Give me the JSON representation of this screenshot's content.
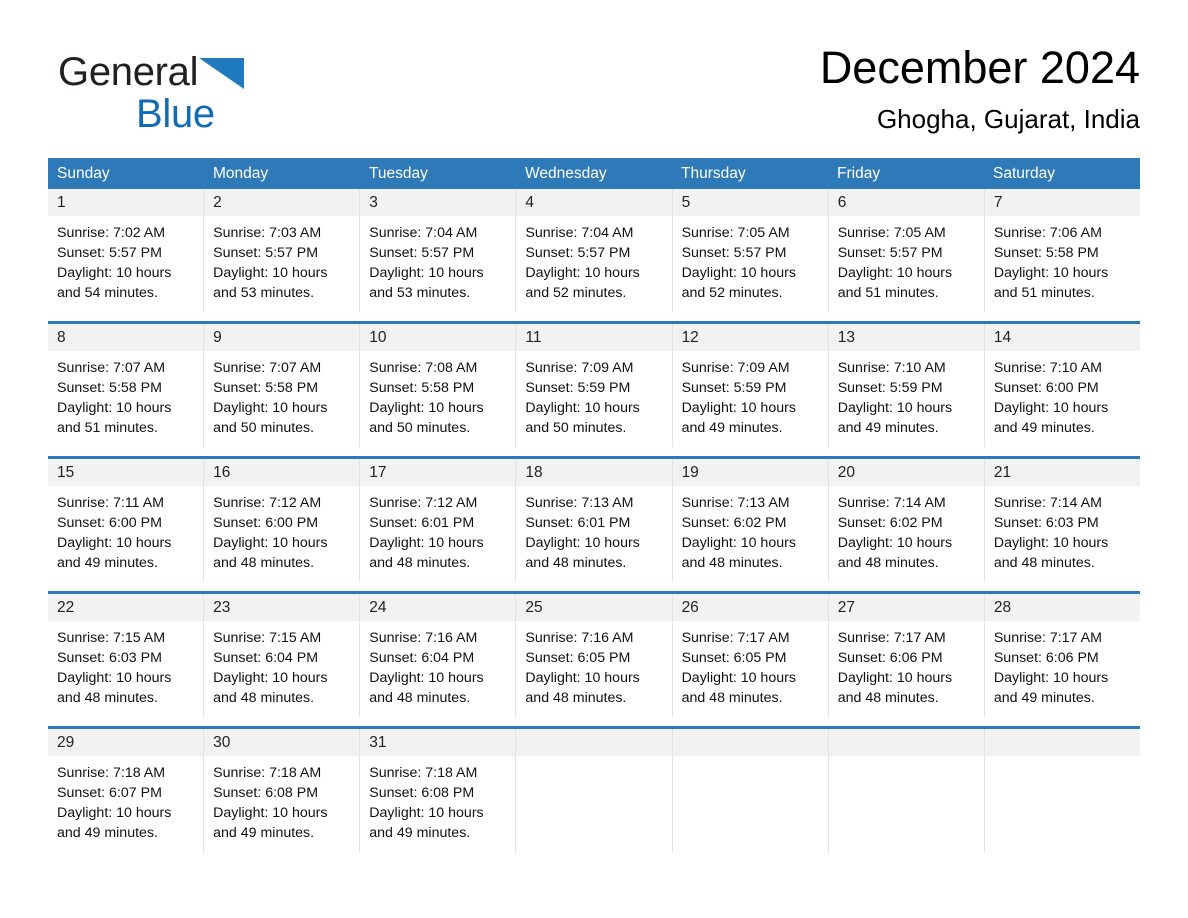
{
  "brand": {
    "name_part1": "General",
    "name_part2": "Blue",
    "triangle_color": "#1f7ac0",
    "text_color_part2": "#0f6cb5"
  },
  "header": {
    "month_title": "December 2024",
    "location": "Ghogha, Gujarat, India"
  },
  "colors": {
    "header_blue": "#2e7ab8",
    "row_rule_blue": "#2e7ab8",
    "day_band_gray": "#f2f2f2",
    "cell_divider": "#e3e3e3"
  },
  "weekdays": [
    "Sunday",
    "Monday",
    "Tuesday",
    "Wednesday",
    "Thursday",
    "Friday",
    "Saturday"
  ],
  "weeks": [
    [
      {
        "day": "1",
        "sunrise": "Sunrise: 7:02 AM",
        "sunset": "Sunset: 5:57 PM",
        "daylight1": "Daylight: 10 hours",
        "daylight2": "and 54 minutes."
      },
      {
        "day": "2",
        "sunrise": "Sunrise: 7:03 AM",
        "sunset": "Sunset: 5:57 PM",
        "daylight1": "Daylight: 10 hours",
        "daylight2": "and 53 minutes."
      },
      {
        "day": "3",
        "sunrise": "Sunrise: 7:04 AM",
        "sunset": "Sunset: 5:57 PM",
        "daylight1": "Daylight: 10 hours",
        "daylight2": "and 53 minutes."
      },
      {
        "day": "4",
        "sunrise": "Sunrise: 7:04 AM",
        "sunset": "Sunset: 5:57 PM",
        "daylight1": "Daylight: 10 hours",
        "daylight2": "and 52 minutes."
      },
      {
        "day": "5",
        "sunrise": "Sunrise: 7:05 AM",
        "sunset": "Sunset: 5:57 PM",
        "daylight1": "Daylight: 10 hours",
        "daylight2": "and 52 minutes."
      },
      {
        "day": "6",
        "sunrise": "Sunrise: 7:05 AM",
        "sunset": "Sunset: 5:57 PM",
        "daylight1": "Daylight: 10 hours",
        "daylight2": "and 51 minutes."
      },
      {
        "day": "7",
        "sunrise": "Sunrise: 7:06 AM",
        "sunset": "Sunset: 5:58 PM",
        "daylight1": "Daylight: 10 hours",
        "daylight2": "and 51 minutes."
      }
    ],
    [
      {
        "day": "8",
        "sunrise": "Sunrise: 7:07 AM",
        "sunset": "Sunset: 5:58 PM",
        "daylight1": "Daylight: 10 hours",
        "daylight2": "and 51 minutes."
      },
      {
        "day": "9",
        "sunrise": "Sunrise: 7:07 AM",
        "sunset": "Sunset: 5:58 PM",
        "daylight1": "Daylight: 10 hours",
        "daylight2": "and 50 minutes."
      },
      {
        "day": "10",
        "sunrise": "Sunrise: 7:08 AM",
        "sunset": "Sunset: 5:58 PM",
        "daylight1": "Daylight: 10 hours",
        "daylight2": "and 50 minutes."
      },
      {
        "day": "11",
        "sunrise": "Sunrise: 7:09 AM",
        "sunset": "Sunset: 5:59 PM",
        "daylight1": "Daylight: 10 hours",
        "daylight2": "and 50 minutes."
      },
      {
        "day": "12",
        "sunrise": "Sunrise: 7:09 AM",
        "sunset": "Sunset: 5:59 PM",
        "daylight1": "Daylight: 10 hours",
        "daylight2": "and 49 minutes."
      },
      {
        "day": "13",
        "sunrise": "Sunrise: 7:10 AM",
        "sunset": "Sunset: 5:59 PM",
        "daylight1": "Daylight: 10 hours",
        "daylight2": "and 49 minutes."
      },
      {
        "day": "14",
        "sunrise": "Sunrise: 7:10 AM",
        "sunset": "Sunset: 6:00 PM",
        "daylight1": "Daylight: 10 hours",
        "daylight2": "and 49 minutes."
      }
    ],
    [
      {
        "day": "15",
        "sunrise": "Sunrise: 7:11 AM",
        "sunset": "Sunset: 6:00 PM",
        "daylight1": "Daylight: 10 hours",
        "daylight2": "and 49 minutes."
      },
      {
        "day": "16",
        "sunrise": "Sunrise: 7:12 AM",
        "sunset": "Sunset: 6:00 PM",
        "daylight1": "Daylight: 10 hours",
        "daylight2": "and 48 minutes."
      },
      {
        "day": "17",
        "sunrise": "Sunrise: 7:12 AM",
        "sunset": "Sunset: 6:01 PM",
        "daylight1": "Daylight: 10 hours",
        "daylight2": "and 48 minutes."
      },
      {
        "day": "18",
        "sunrise": "Sunrise: 7:13 AM",
        "sunset": "Sunset: 6:01 PM",
        "daylight1": "Daylight: 10 hours",
        "daylight2": "and 48 minutes."
      },
      {
        "day": "19",
        "sunrise": "Sunrise: 7:13 AM",
        "sunset": "Sunset: 6:02 PM",
        "daylight1": "Daylight: 10 hours",
        "daylight2": "and 48 minutes."
      },
      {
        "day": "20",
        "sunrise": "Sunrise: 7:14 AM",
        "sunset": "Sunset: 6:02 PM",
        "daylight1": "Daylight: 10 hours",
        "daylight2": "and 48 minutes."
      },
      {
        "day": "21",
        "sunrise": "Sunrise: 7:14 AM",
        "sunset": "Sunset: 6:03 PM",
        "daylight1": "Daylight: 10 hours",
        "daylight2": "and 48 minutes."
      }
    ],
    [
      {
        "day": "22",
        "sunrise": "Sunrise: 7:15 AM",
        "sunset": "Sunset: 6:03 PM",
        "daylight1": "Daylight: 10 hours",
        "daylight2": "and 48 minutes."
      },
      {
        "day": "23",
        "sunrise": "Sunrise: 7:15 AM",
        "sunset": "Sunset: 6:04 PM",
        "daylight1": "Daylight: 10 hours",
        "daylight2": "and 48 minutes."
      },
      {
        "day": "24",
        "sunrise": "Sunrise: 7:16 AM",
        "sunset": "Sunset: 6:04 PM",
        "daylight1": "Daylight: 10 hours",
        "daylight2": "and 48 minutes."
      },
      {
        "day": "25",
        "sunrise": "Sunrise: 7:16 AM",
        "sunset": "Sunset: 6:05 PM",
        "daylight1": "Daylight: 10 hours",
        "daylight2": "and 48 minutes."
      },
      {
        "day": "26",
        "sunrise": "Sunrise: 7:17 AM",
        "sunset": "Sunset: 6:05 PM",
        "daylight1": "Daylight: 10 hours",
        "daylight2": "and 48 minutes."
      },
      {
        "day": "27",
        "sunrise": "Sunrise: 7:17 AM",
        "sunset": "Sunset: 6:06 PM",
        "daylight1": "Daylight: 10 hours",
        "daylight2": "and 48 minutes."
      },
      {
        "day": "28",
        "sunrise": "Sunrise: 7:17 AM",
        "sunset": "Sunset: 6:06 PM",
        "daylight1": "Daylight: 10 hours",
        "daylight2": "and 49 minutes."
      }
    ],
    [
      {
        "day": "29",
        "sunrise": "Sunrise: 7:18 AM",
        "sunset": "Sunset: 6:07 PM",
        "daylight1": "Daylight: 10 hours",
        "daylight2": "and 49 minutes."
      },
      {
        "day": "30",
        "sunrise": "Sunrise: 7:18 AM",
        "sunset": "Sunset: 6:08 PM",
        "daylight1": "Daylight: 10 hours",
        "daylight2": "and 49 minutes."
      },
      {
        "day": "31",
        "sunrise": "Sunrise: 7:18 AM",
        "sunset": "Sunset: 6:08 PM",
        "daylight1": "Daylight: 10 hours",
        "daylight2": "and 49 minutes."
      },
      {
        "day": "",
        "sunrise": "",
        "sunset": "",
        "daylight1": "",
        "daylight2": ""
      },
      {
        "day": "",
        "sunrise": "",
        "sunset": "",
        "daylight1": "",
        "daylight2": ""
      },
      {
        "day": "",
        "sunrise": "",
        "sunset": "",
        "daylight1": "",
        "daylight2": ""
      },
      {
        "day": "",
        "sunrise": "",
        "sunset": "",
        "daylight1": "",
        "daylight2": ""
      }
    ]
  ]
}
